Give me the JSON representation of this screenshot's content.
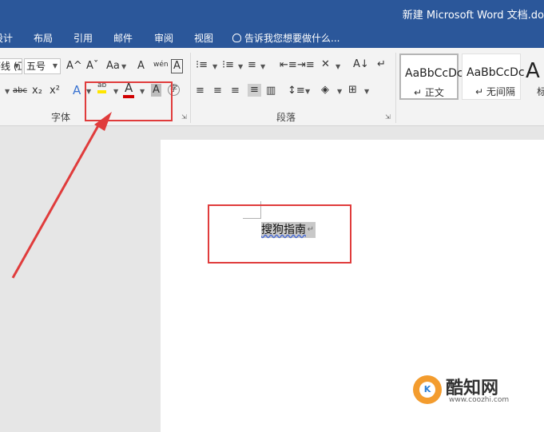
{
  "window": {
    "title": "新建 Microsoft Word 文档.do"
  },
  "tabs": [
    "设计",
    "布局",
    "引用",
    "邮件",
    "审阅",
    "视图"
  ],
  "tell_me": {
    "text": "告诉我您想要做什么..."
  },
  "font_group": {
    "label": "字体",
    "font_name": "等线 (正文",
    "font_size": "五号",
    "grow_icon": "A^",
    "shrink_icon": "Aˇ",
    "case_icon": "Aa",
    "clear_icon": "A",
    "phonetic_icon": "wén",
    "border_char_icon": "A",
    "strike_icon": "abc",
    "subscript_icon": "x₂",
    "superscript_icon": "x²",
    "effects_icon": "A",
    "highlight_icon": "ab",
    "font_color_icon": "A",
    "shading_icon": "A",
    "enclose_icon": "字"
  },
  "paragraph_group": {
    "label": "段落"
  },
  "styles": [
    {
      "sample": "AaBbCcDc",
      "name": "正文"
    },
    {
      "sample": "AaBbCcDc",
      "name": "无间隔"
    },
    {
      "sample": "A",
      "name": "标"
    }
  ],
  "document": {
    "selected_text": "搜狗指南"
  },
  "colors": {
    "titlebar": "#2b579a",
    "highlight": "#ffe600",
    "font_color": "#d00000",
    "annotation": "#e03c3c"
  },
  "watermark": {
    "name": "酷知网",
    "url": "www.coozhi.com",
    "logo_letter": "K"
  }
}
